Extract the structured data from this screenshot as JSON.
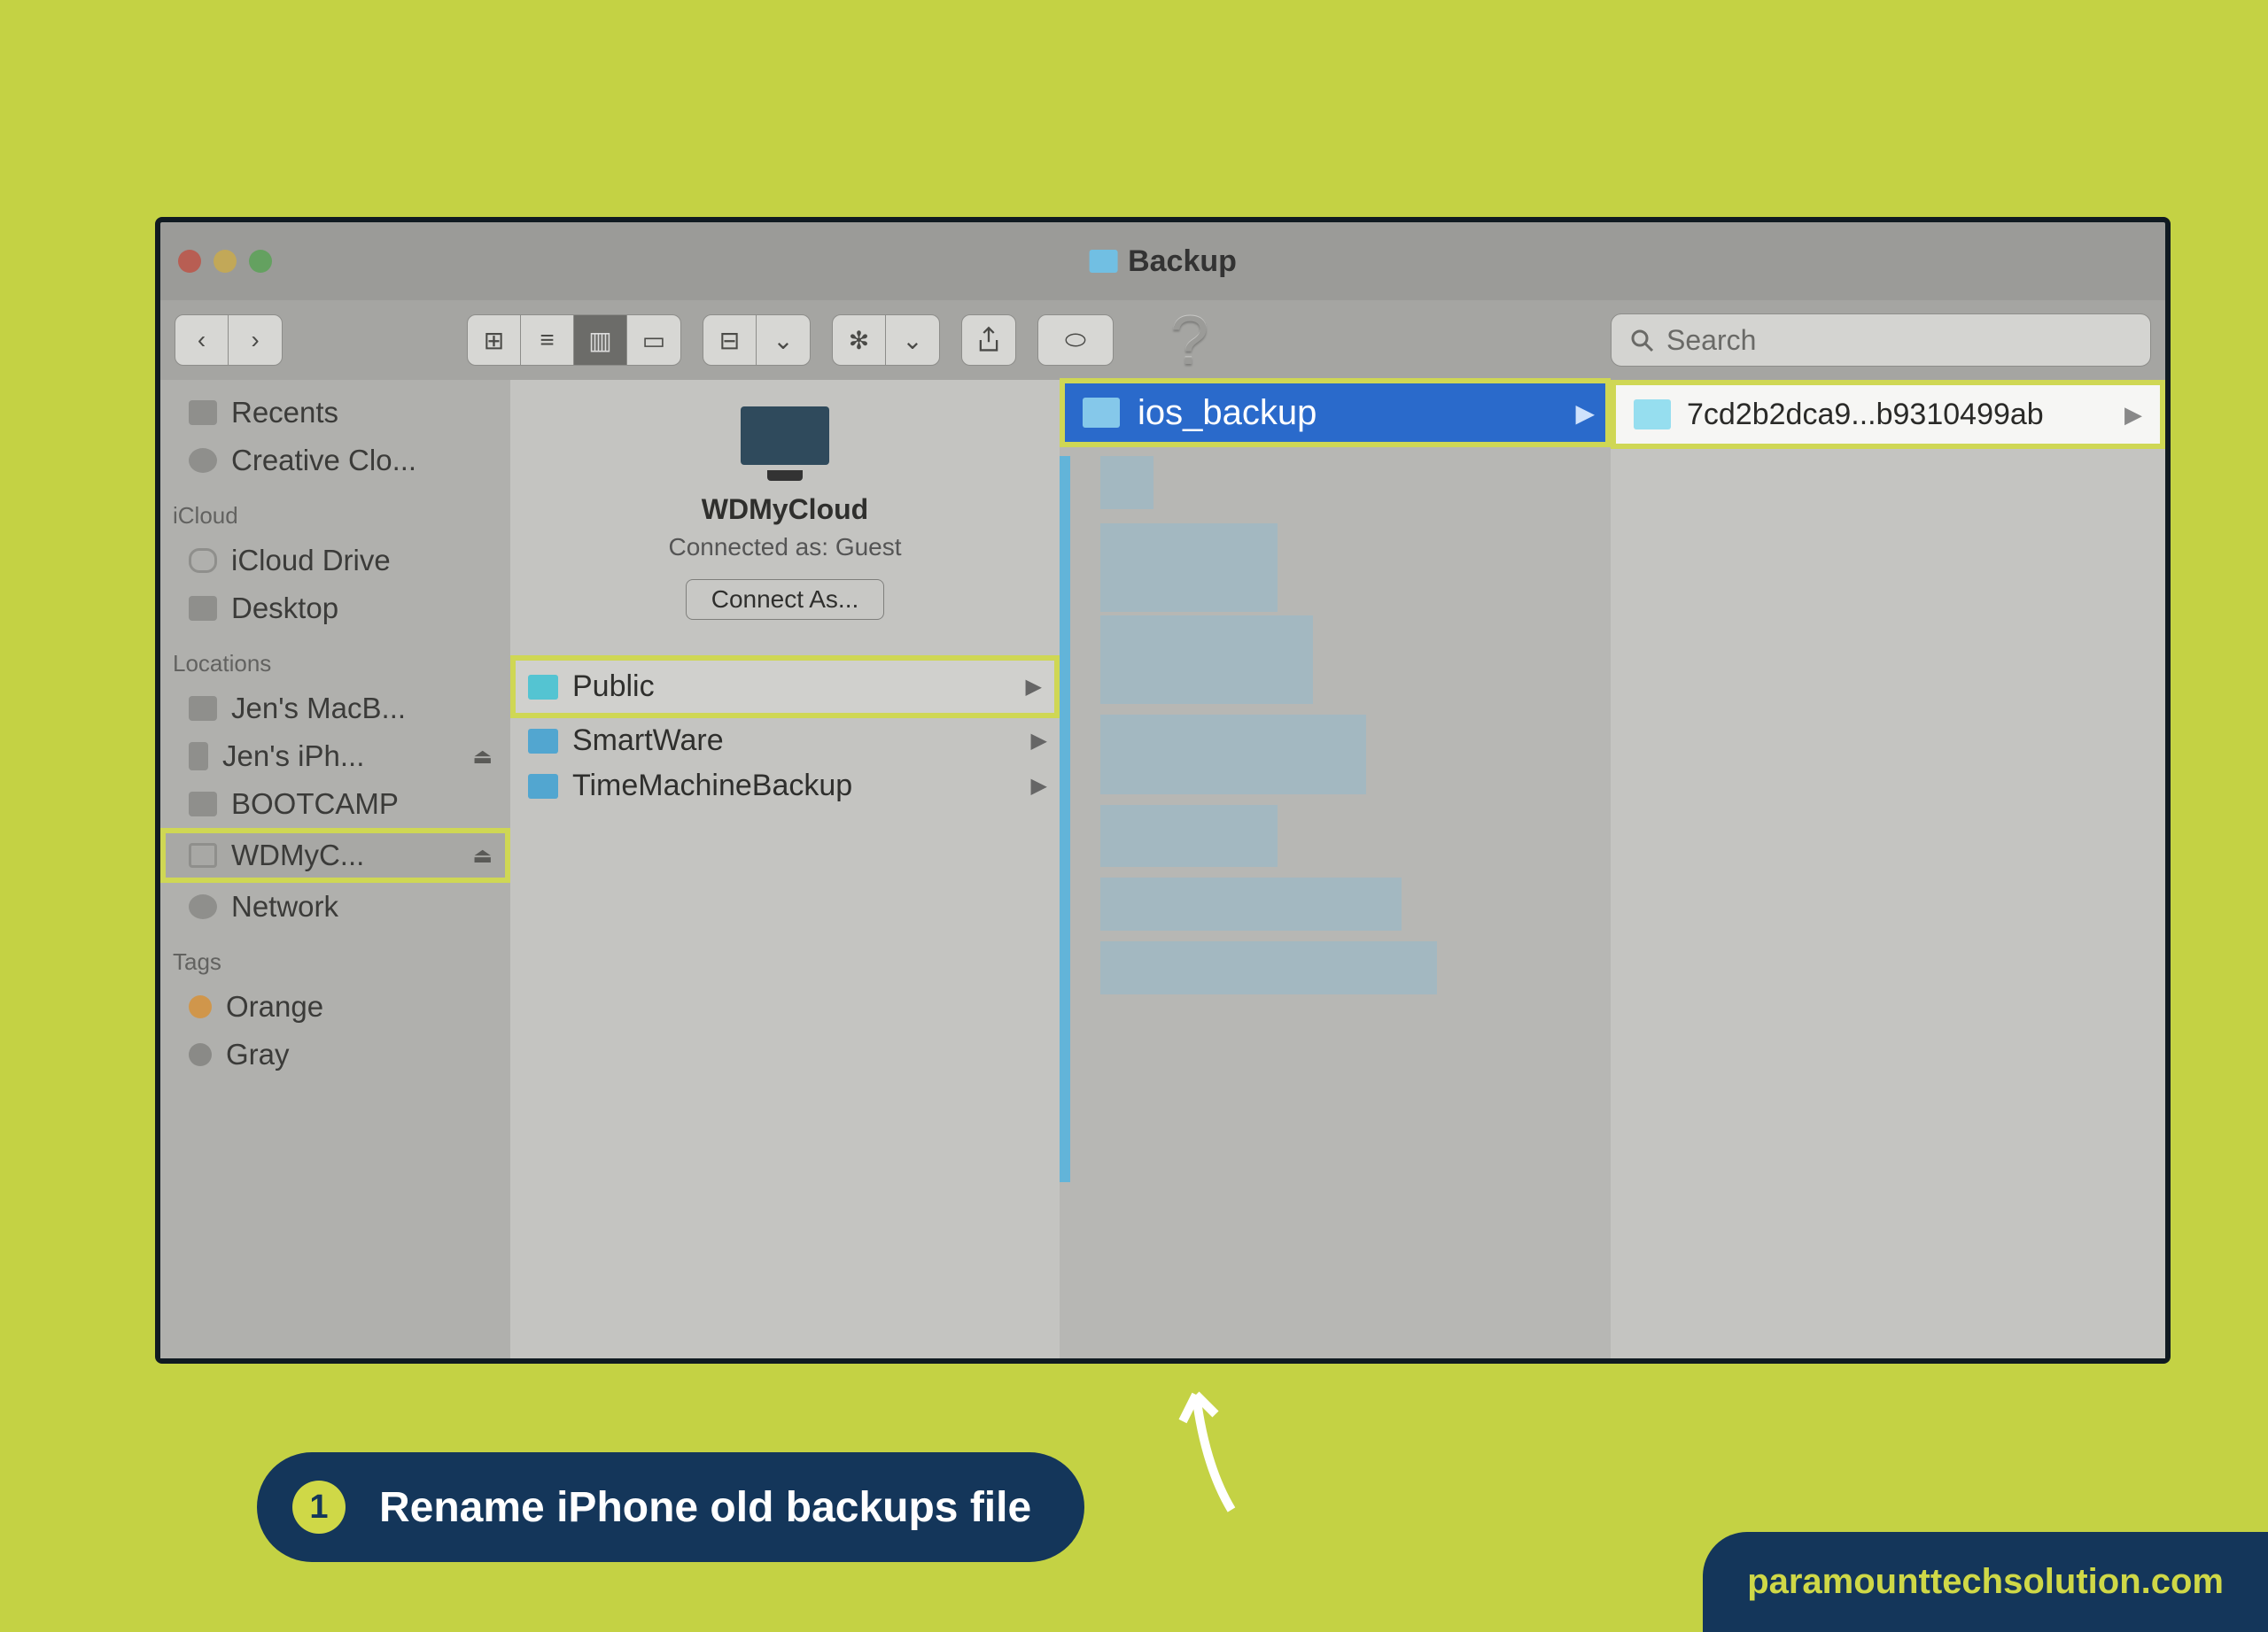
{
  "window": {
    "title": "Backup",
    "search_placeholder": "Search"
  },
  "sidebar": {
    "favorites": [
      {
        "label": "Recents"
      },
      {
        "label": "Creative Clo..."
      }
    ],
    "icloud_header": "iCloud",
    "icloud": [
      {
        "label": "iCloud Drive"
      },
      {
        "label": "Desktop"
      }
    ],
    "locations_header": "Locations",
    "locations": [
      {
        "label": "Jen's MacB..."
      },
      {
        "label": "Jen's iPh...",
        "eject": "⏏"
      },
      {
        "label": "BOOTCAMP"
      },
      {
        "label": "WDMyC...",
        "eject": "⏏",
        "highlight": true
      }
    ],
    "network_label": "Network",
    "tags_header": "Tags",
    "tags": [
      {
        "label": "Orange",
        "color": "#d69542"
      },
      {
        "label": "Gray",
        "color": "#8a8a87"
      }
    ]
  },
  "col1": {
    "server_name": "WDMyCloud",
    "connected_as": "Connected as: Guest",
    "connect_button": "Connect As...",
    "folders": [
      {
        "label": "Public",
        "highlight": true
      },
      {
        "label": "SmartWare"
      },
      {
        "label": "TimeMachineBackup"
      }
    ]
  },
  "col2": {
    "selected_folder": "ios_backup"
  },
  "col3": {
    "selected_folder": "7cd2b2dca9...b9310499ab"
  },
  "caption": {
    "step": "1",
    "text": "Rename iPhone old backups file"
  },
  "credit": "paramounttechsolution.com"
}
